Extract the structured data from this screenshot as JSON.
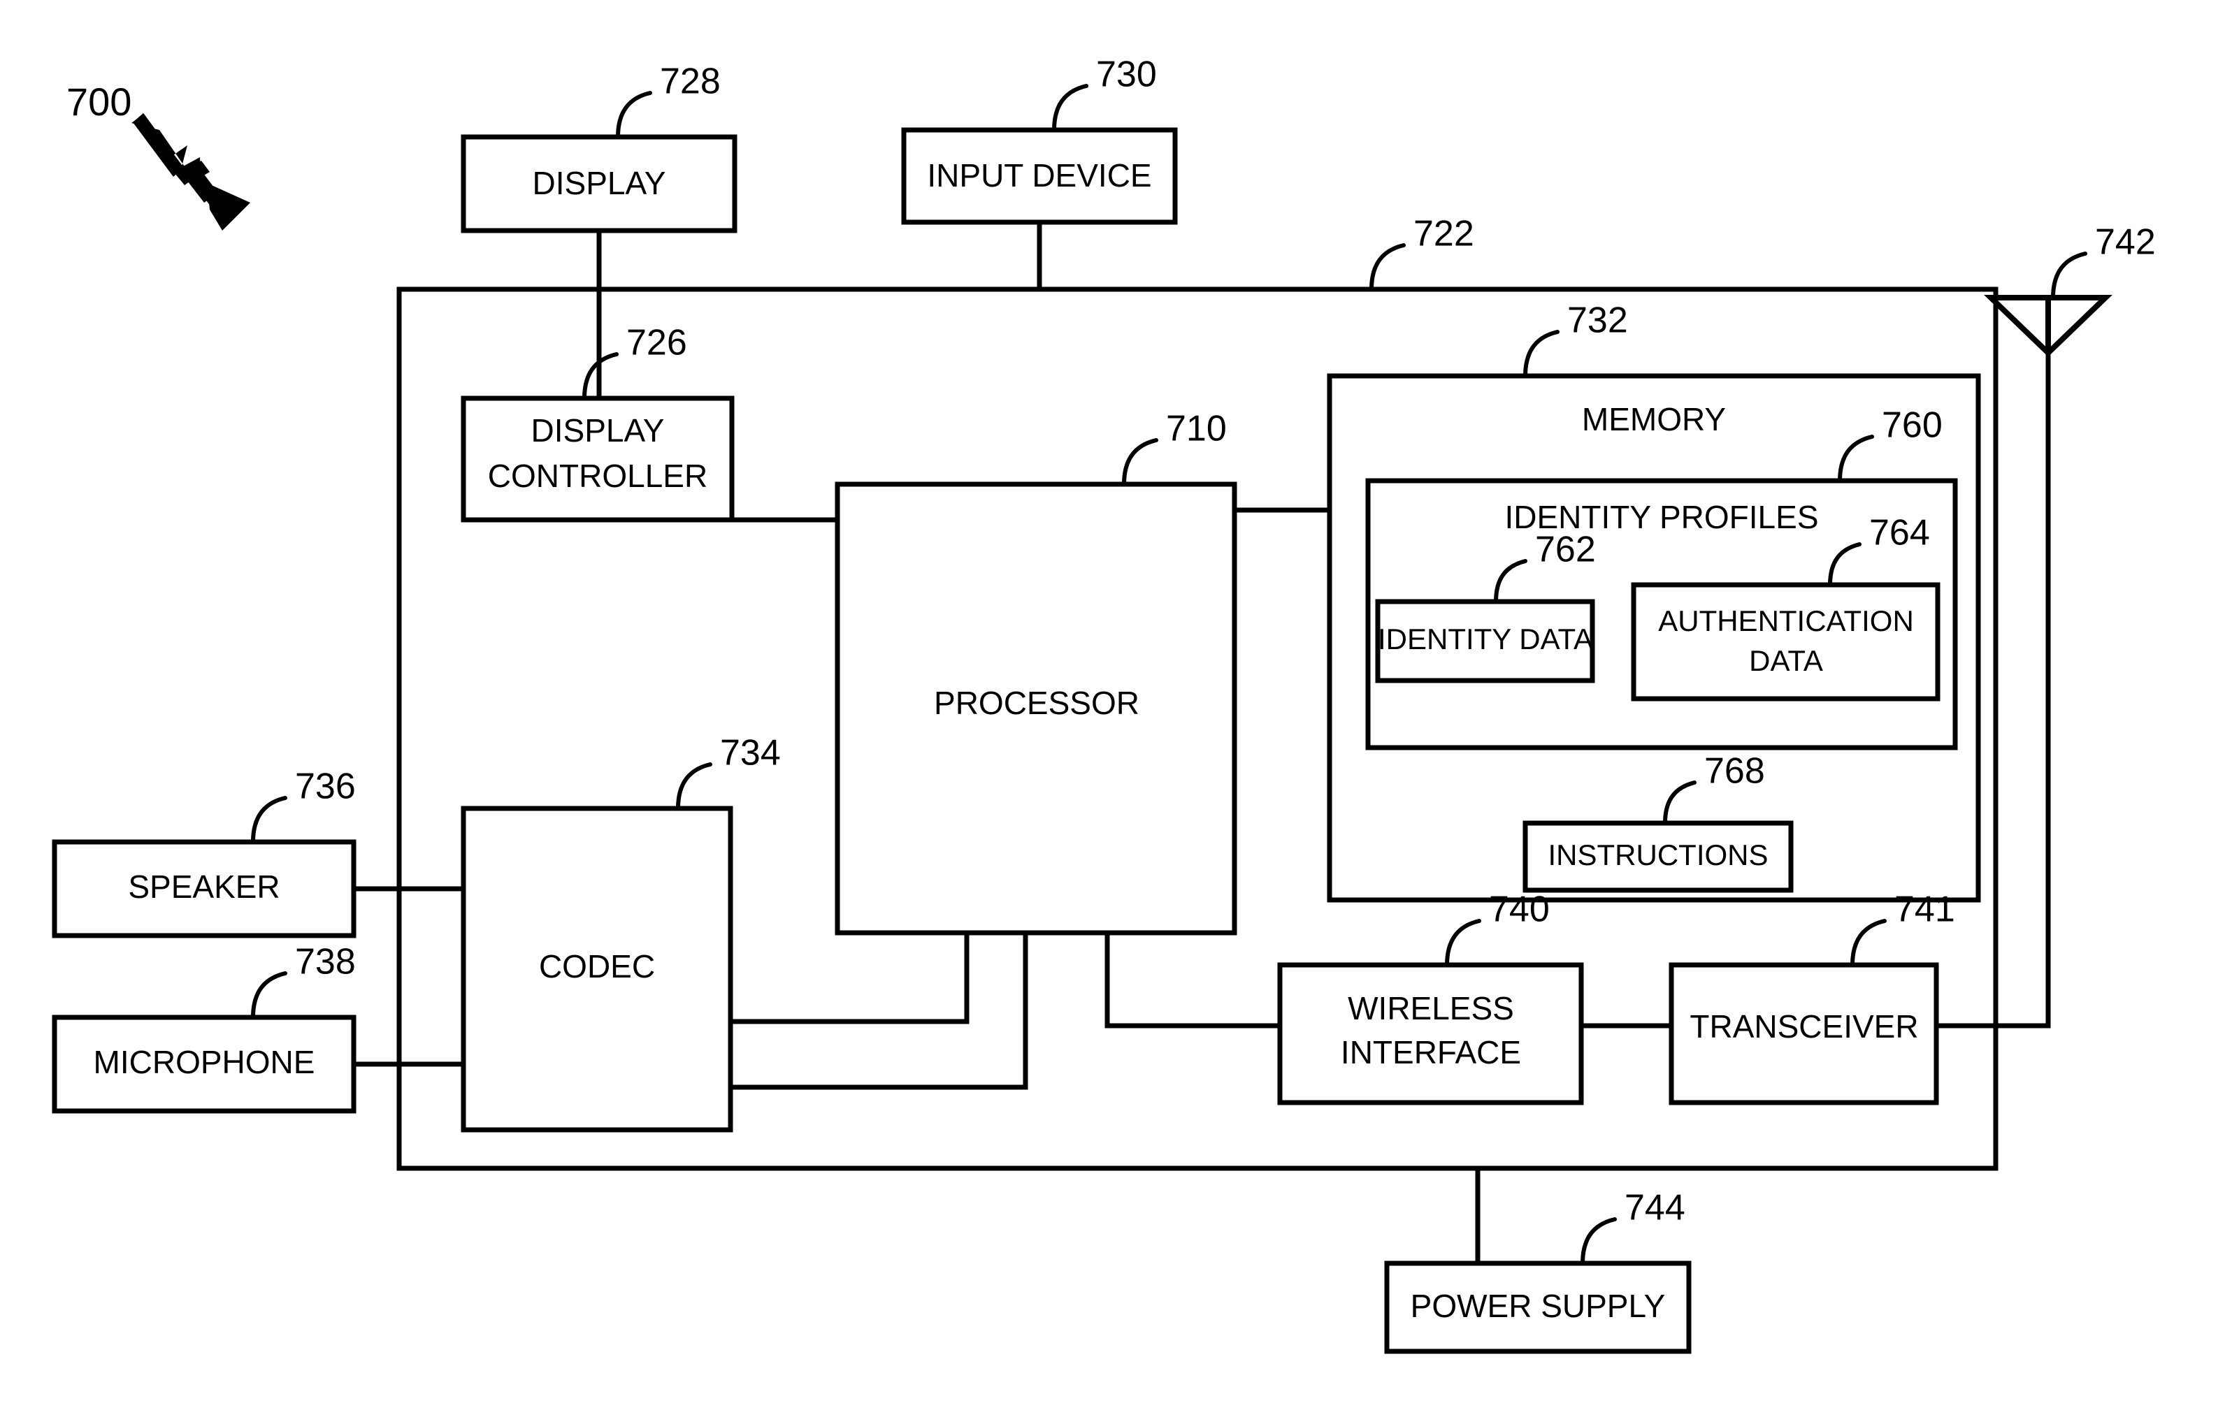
{
  "figure": {
    "number": "700",
    "type": "patent-block-diagram"
  },
  "blocks": {
    "display": {
      "label": "DISPLAY",
      "ref": "728"
    },
    "input_device": {
      "label": "INPUT DEVICE",
      "ref": "730"
    },
    "display_controller": {
      "label_line1": "DISPLAY",
      "label_line2": "CONTROLLER",
      "ref": "726"
    },
    "processor": {
      "label": "PROCESSOR",
      "ref": "710"
    },
    "memory": {
      "label": "MEMORY",
      "ref": "732"
    },
    "identity_profiles": {
      "label": "IDENTITY PROFILES",
      "ref": "760"
    },
    "identity_data": {
      "label": "IDENTITY DATA",
      "ref": "762"
    },
    "authentication_data": {
      "label_line1": "AUTHENTICATION",
      "label_line2": "DATA",
      "ref": "764"
    },
    "instructions": {
      "label": "INSTRUCTIONS",
      "ref": "768"
    },
    "codec": {
      "label": "CODEC",
      "ref": "734"
    },
    "speaker": {
      "label": "SPEAKER",
      "ref": "736"
    },
    "microphone": {
      "label": "MICROPHONE",
      "ref": "738"
    },
    "wireless_interface": {
      "label_line1": "WIRELESS",
      "label_line2": "INTERFACE",
      "ref": "740"
    },
    "transceiver": {
      "label": "TRANSCEIVER",
      "ref": "741"
    },
    "power_supply": {
      "label": "POWER SUPPLY",
      "ref": "744"
    },
    "system_bus": {
      "ref": "722"
    },
    "antenna": {
      "ref": "742"
    }
  },
  "colors": {
    "line": "#000000",
    "fill": "#ffffff",
    "text": "#000000"
  }
}
